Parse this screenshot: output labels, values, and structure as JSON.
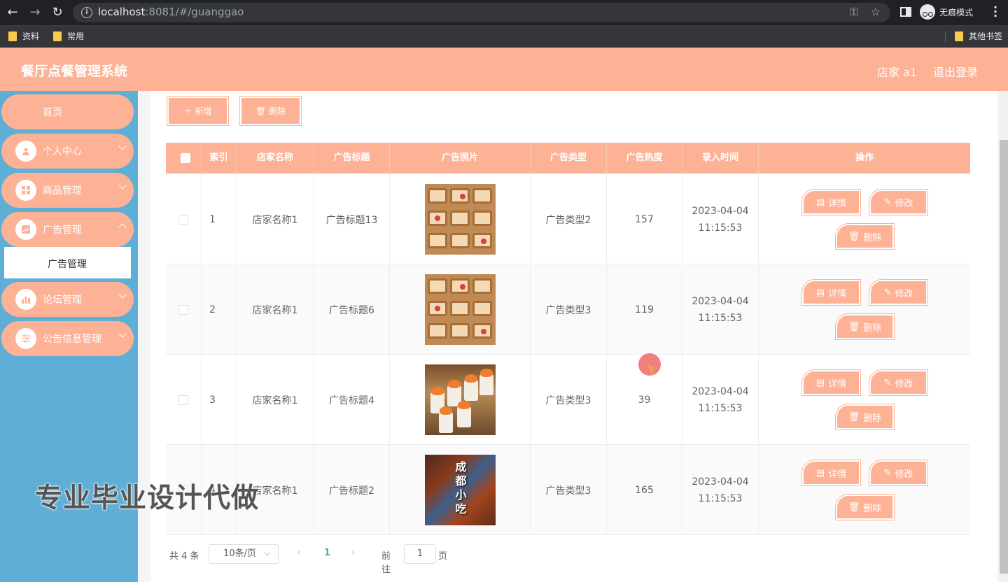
{
  "browser": {
    "url_host": "localhost",
    "url_rest": ":8081/#/guanggao",
    "incognito_label": "无痕模式",
    "bookmarks": [
      "资料",
      "常用"
    ],
    "other_bookmarks": "其他书签"
  },
  "header": {
    "title": "餐厅点餐管理系统",
    "user": "店家 a1",
    "logout": "退出登录",
    "bg_color": "#fdb195"
  },
  "sidebar": {
    "home": "首页",
    "items": [
      {
        "label": "个人中心"
      },
      {
        "label": "商品管理"
      },
      {
        "label": "广告管理"
      },
      {
        "label": "论坛管理"
      },
      {
        "label": "公告信息管理"
      }
    ],
    "active_sub": "广告管理",
    "bg_color": "#5eaed6"
  },
  "toolbar": {
    "add_label": "新增",
    "delete_label": "删除"
  },
  "table": {
    "headers": [
      "索引",
      "店家名称",
      "广告标题",
      "广告照片",
      "广告类型",
      "广告热度",
      "录入时间",
      "操作"
    ],
    "rows": [
      {
        "index": "1",
        "shop": "店家名称1",
        "title": "广告标题13",
        "type": "广告类型2",
        "heat": "157",
        "date": "2023-04-04",
        "time": "11:15:53",
        "photo": "bento"
      },
      {
        "index": "2",
        "shop": "店家名称1",
        "title": "广告标题6",
        "type": "广告类型3",
        "heat": "119",
        "date": "2023-04-04",
        "time": "11:15:53",
        "photo": "bento"
      },
      {
        "index": "3",
        "shop": "店家名称1",
        "title": "广告标题4",
        "type": "广告类型3",
        "heat": "39",
        "date": "2023-04-04",
        "time": "11:15:53",
        "photo": "sushi"
      },
      {
        "index": "4",
        "shop": "店家名称1",
        "title": "广告标题2",
        "type": "广告类型3",
        "heat": "165",
        "date": "2023-04-04",
        "time": "11:15:53",
        "photo": "chengdu"
      }
    ],
    "op_detail": "详情",
    "op_edit": "修改",
    "op_delete": "删除",
    "photo_text": [
      "成",
      "都",
      "小",
      "吃"
    ]
  },
  "pagination": {
    "total": "共 4 条",
    "page_size": "10条/页",
    "current": "1",
    "goto_label": "前往",
    "goto_value": "1",
    "page_suffix": "页"
  },
  "watermark": "专业毕业设计代做"
}
